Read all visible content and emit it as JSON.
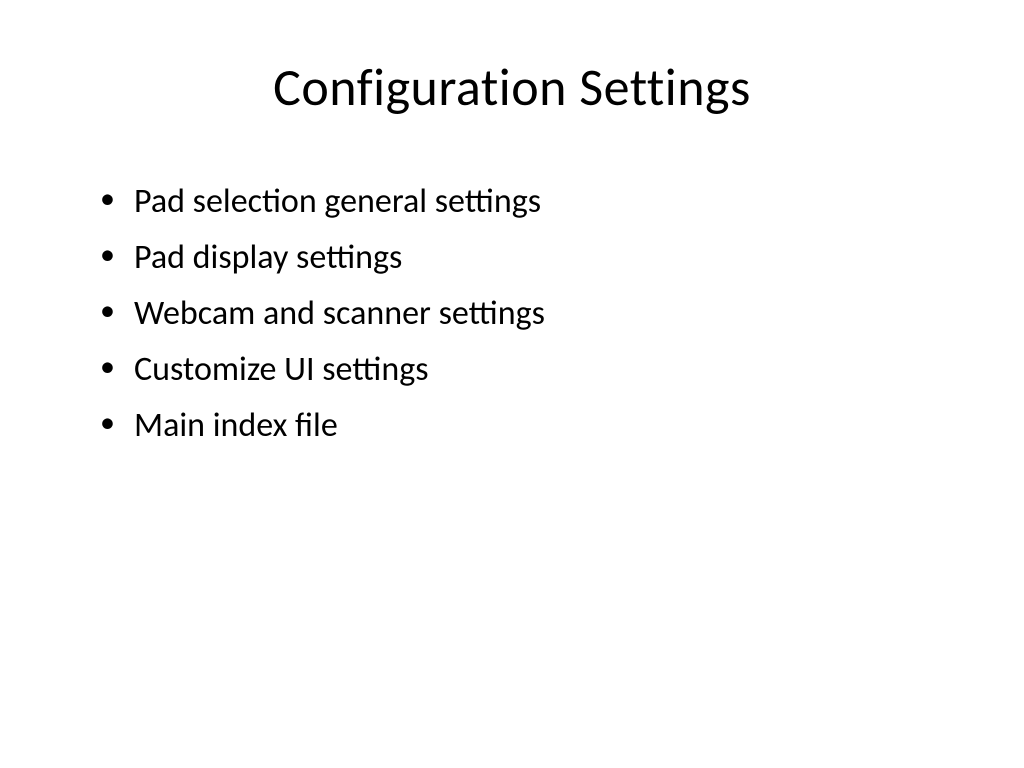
{
  "slide": {
    "title": "Configuration Settings",
    "bullets": [
      "Pad selection general settings",
      "Pad display settings",
      "Webcam and scanner settings",
      "Customize UI settings",
      "Main index file"
    ]
  }
}
